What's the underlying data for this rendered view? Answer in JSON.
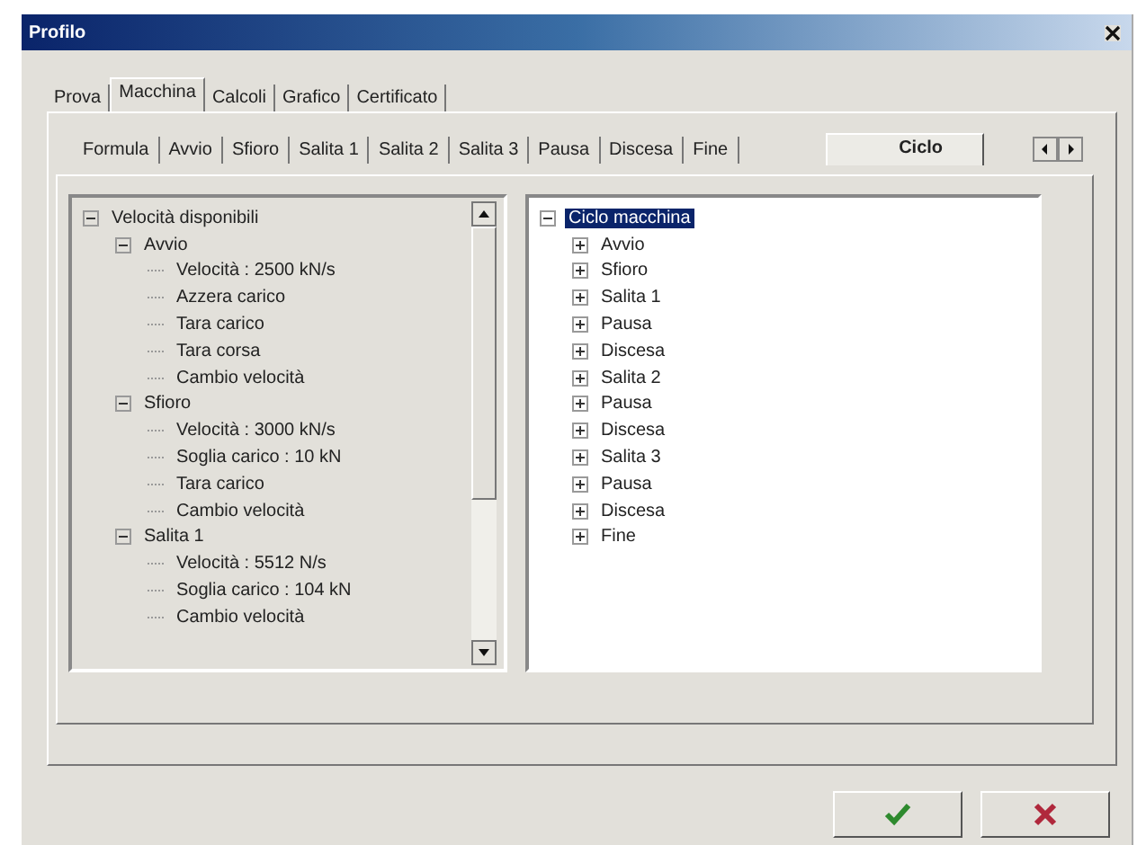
{
  "window": {
    "title": "Profilo"
  },
  "outer_tabs": [
    {
      "label": "Prova",
      "selected": false
    },
    {
      "label": "Macchina",
      "selected": true
    },
    {
      "label": "Calcoli",
      "selected": false
    },
    {
      "label": "Grafico",
      "selected": false
    },
    {
      "label": "Certificato",
      "selected": false
    }
  ],
  "inner_tabs": [
    {
      "label": "Formula",
      "selected": false
    },
    {
      "label": "Avvio",
      "selected": false
    },
    {
      "label": "Sfioro",
      "selected": false
    },
    {
      "label": "Salita 1",
      "selected": false
    },
    {
      "label": "Salita 2",
      "selected": false
    },
    {
      "label": "Salita 3",
      "selected": false
    },
    {
      "label": "Pausa",
      "selected": false
    },
    {
      "label": "Discesa",
      "selected": false
    },
    {
      "label": "Fine",
      "selected": false
    },
    {
      "label": "Ciclo",
      "selected": true
    }
  ],
  "left_tree": [
    {
      "label": "Velocità disponibili",
      "expanded": true,
      "children": [
        {
          "label": "Avvio",
          "expanded": true,
          "children": [
            {
              "label": "Velocità : 2500 kN/s"
            },
            {
              "label": "Azzera carico"
            },
            {
              "label": "Tara carico"
            },
            {
              "label": "Tara corsa"
            },
            {
              "label": "Cambio velocità"
            }
          ]
        },
        {
          "label": "Sfioro",
          "expanded": true,
          "children": [
            {
              "label": "Velocità : 3000 kN/s"
            },
            {
              "label": "Soglia carico : 10 kN"
            },
            {
              "label": "Tara carico"
            },
            {
              "label": "Cambio velocità"
            }
          ]
        },
        {
          "label": "Salita 1",
          "expanded": true,
          "children": [
            {
              "label": "Velocità : 5512 N/s"
            },
            {
              "label": "Soglia carico : 104 kN"
            },
            {
              "label": "Cambio velocità"
            }
          ]
        }
      ]
    }
  ],
  "right_tree": [
    {
      "label": "Ciclo macchina",
      "expanded": true,
      "selected": true,
      "children": [
        {
          "label": "Avvio",
          "expanded": false,
          "selected": false
        },
        {
          "label": "Sfioro",
          "expanded": false,
          "selected": false
        },
        {
          "label": "Salita 1",
          "expanded": false,
          "selected": false
        },
        {
          "label": "Pausa",
          "expanded": false,
          "selected": false
        },
        {
          "label": "Discesa",
          "expanded": false,
          "selected": false
        },
        {
          "label": "Salita 2",
          "expanded": false,
          "selected": false
        },
        {
          "label": "Pausa",
          "expanded": false,
          "selected": false
        },
        {
          "label": "Discesa",
          "expanded": false,
          "selected": false
        },
        {
          "label": "Salita 3",
          "expanded": false,
          "selected": false
        },
        {
          "label": "Pausa",
          "expanded": false,
          "selected": false
        },
        {
          "label": "Discesa",
          "expanded": false,
          "selected": false
        },
        {
          "label": "Fine",
          "expanded": false,
          "selected": false
        }
      ]
    }
  ],
  "buttons": [
    {
      "kind": "ok"
    },
    {
      "kind": "cancel"
    }
  ]
}
